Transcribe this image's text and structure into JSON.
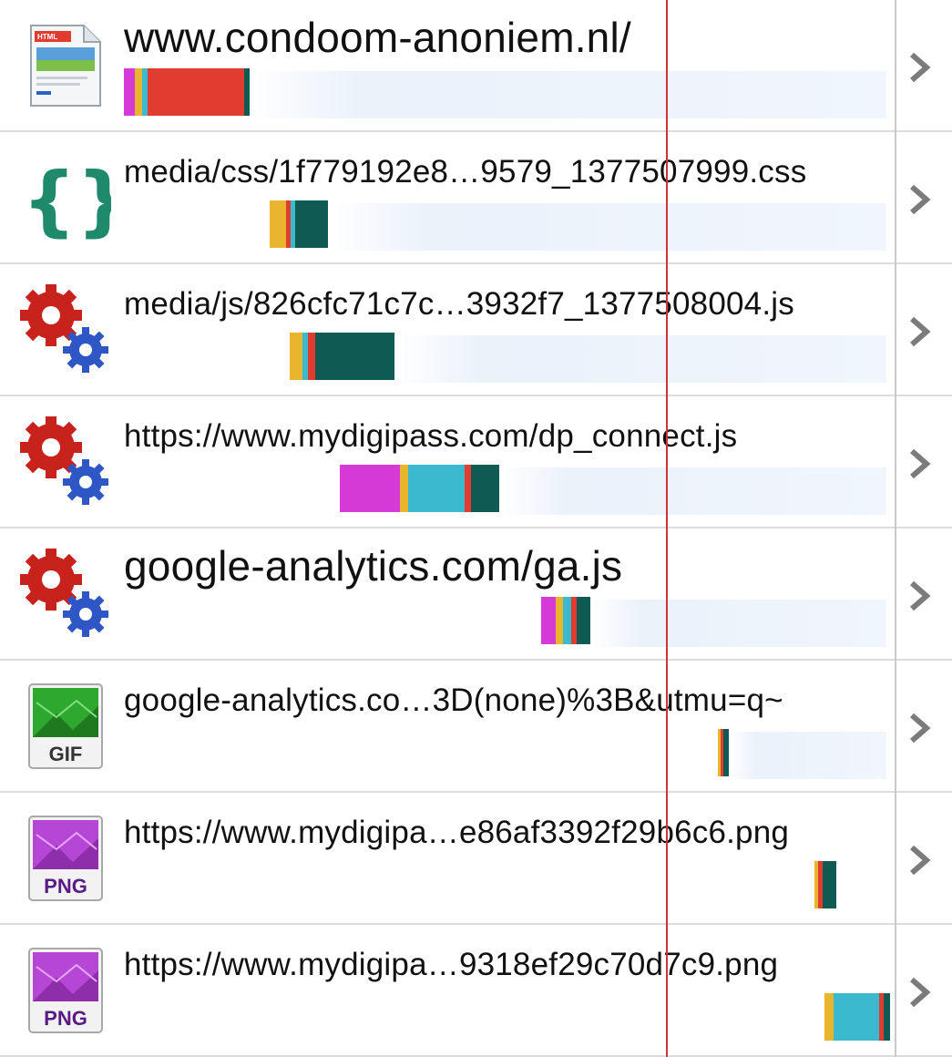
{
  "requests": [
    {
      "url": "www.condoom-anoniem.nl/",
      "type": "html-icon",
      "size": "big"
    },
    {
      "url": "media/css/1f779192e8…9579_1377507999.css",
      "type": "css-icon",
      "size": "small"
    },
    {
      "url": "media/js/826cfc71c7c…3932f7_1377508004.js",
      "type": "js-icon",
      "size": "small"
    },
    {
      "url": "https://www.mydigipass.com/dp_connect.js",
      "type": "js-icon",
      "size": "small"
    },
    {
      "url": "google-analytics.com/ga.js",
      "type": "js-icon",
      "size": "big"
    },
    {
      "url": "google-analytics.co…3D(none)%3B&utmu=q~",
      "type": "gif-icon",
      "size": "small",
      "badge": "GIF"
    },
    {
      "url": "https://www.mydigipa…e86af3392f29b6c6.png",
      "type": "png-icon",
      "size": "small",
      "badge": "PNG"
    },
    {
      "url": "https://www.mydigipa…9318ef29c70d7c9.png",
      "type": "png-icon",
      "size": "small",
      "badge": "PNG"
    }
  ],
  "colors": {
    "dns": "#d63ad6",
    "connect": "#e8b52c",
    "ssl": "#3ab9cf",
    "ttfb": "#e23b2f",
    "download": "#0f5a52",
    "marker": "#d2333a"
  }
}
